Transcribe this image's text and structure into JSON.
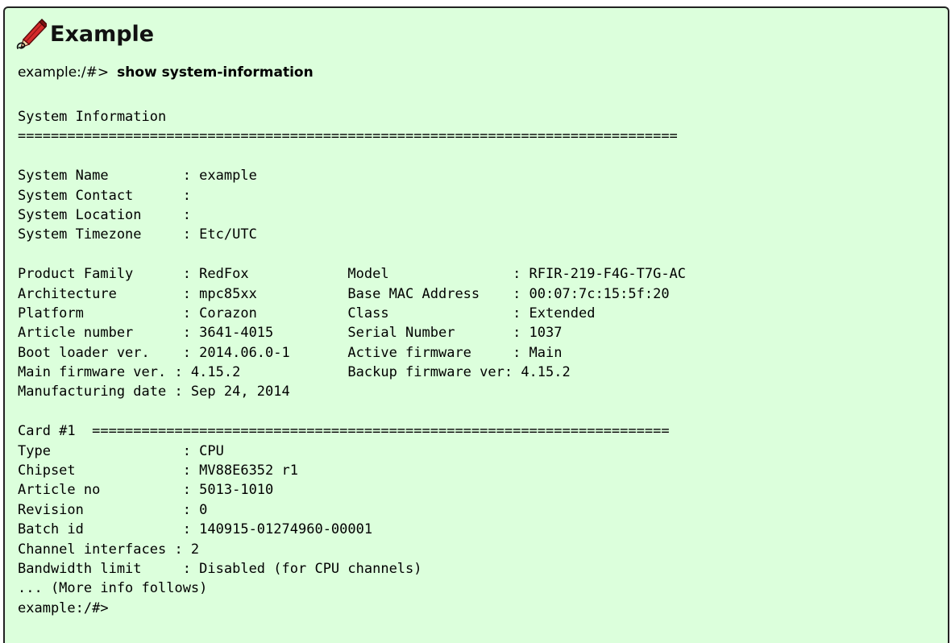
{
  "header": {
    "title": "Example",
    "icon": "pencil-icon"
  },
  "command": {
    "prompt": "example:/#>",
    "text": "show system-information"
  },
  "output": {
    "lines": [
      "System Information",
      "================================================================================",
      "",
      "System Name         : example",
      "System Contact      :",
      "System Location     :",
      "System Timezone     : Etc/UTC",
      "",
      "Product Family      : RedFox            Model               : RFIR-219-F4G-T7G-AC",
      "Architecture        : mpc85xx           Base MAC Address    : 00:07:7c:15:5f:20",
      "Platform            : Corazon           Class               : Extended",
      "Article number      : 3641-4015         Serial Number       : 1037",
      "Boot loader ver.    : 2014.06.0-1       Active firmware     : Main",
      "Main firmware ver. : 4.15.2             Backup firmware ver: 4.15.2",
      "Manufacturing date : Sep 24, 2014",
      "",
      "Card #1  ======================================================================",
      "Type                : CPU",
      "Chipset             : MV88E6352 r1",
      "Article no          : 5013-1010",
      "Revision            : 0",
      "Batch id            : 140915-01274960-00001",
      "Channel interfaces : 2",
      "Bandwidth limit     : Disabled (for CPU channels)",
      "... (More info follows)",
      "example:/#>"
    ]
  },
  "colors": {
    "panel_background": "#dcffdc",
    "border": "#222222",
    "icon_red": "#d42a2a"
  }
}
